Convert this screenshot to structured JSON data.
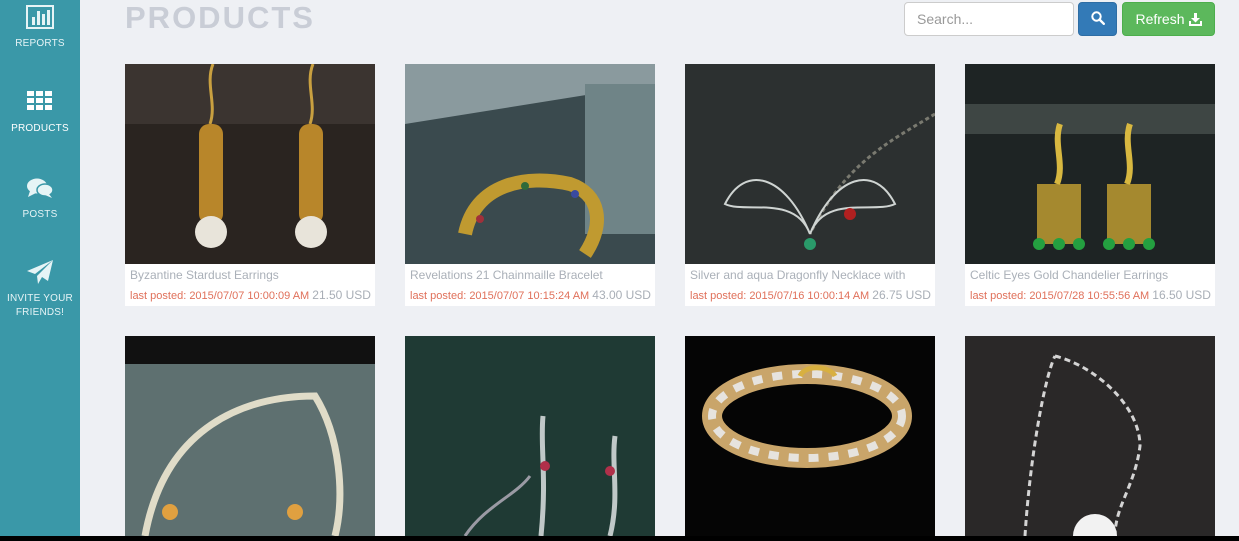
{
  "sidebar": {
    "items": [
      {
        "label": "REPORTS",
        "icon": "bar-chart-icon"
      },
      {
        "label": "PRODUCTS",
        "icon": "grid-icon"
      },
      {
        "label": "POSTS",
        "icon": "chat-bubbles-icon"
      },
      {
        "label_line1": "INVITE YOUR",
        "label_line2": "FRIENDS!",
        "icon": "paper-plane-icon"
      }
    ]
  },
  "header": {
    "title": "PRODUCTS",
    "search_placeholder": "Search...",
    "search_icon": "search-icon",
    "refresh_label": "Refresh",
    "refresh_icon": "download-icon"
  },
  "products": [
    {
      "name": "Byzantine Stardust Earrings",
      "posted": "last posted: 2015/07/07 10:00:09 AM",
      "price": "21.50 USD"
    },
    {
      "name": "Revelations 21 Chainmaille Bracelet",
      "posted": "last posted: 2015/07/07 10:15:24 AM",
      "price": "43.00 USD"
    },
    {
      "name": "Silver and aqua Dragonfly Necklace with",
      "posted": "last posted: 2015/07/16 10:00:14 AM",
      "price": "26.75 USD"
    },
    {
      "name": "Celtic Eyes Gold Chandelier Earrings",
      "posted": "last posted: 2015/07/28 10:55:56 AM",
      "price": "16.50 USD"
    },
    {
      "name": "",
      "posted": "",
      "price": ""
    },
    {
      "name": "",
      "posted": "",
      "price": ""
    },
    {
      "name": "",
      "posted": "",
      "price": ""
    },
    {
      "name": "",
      "posted": "",
      "price": ""
    }
  ],
  "colors": {
    "sidebar": "#3a98a8",
    "search_button": "#337ab7",
    "refresh_button": "#5cb85c",
    "posted_text": "#e0705a"
  }
}
